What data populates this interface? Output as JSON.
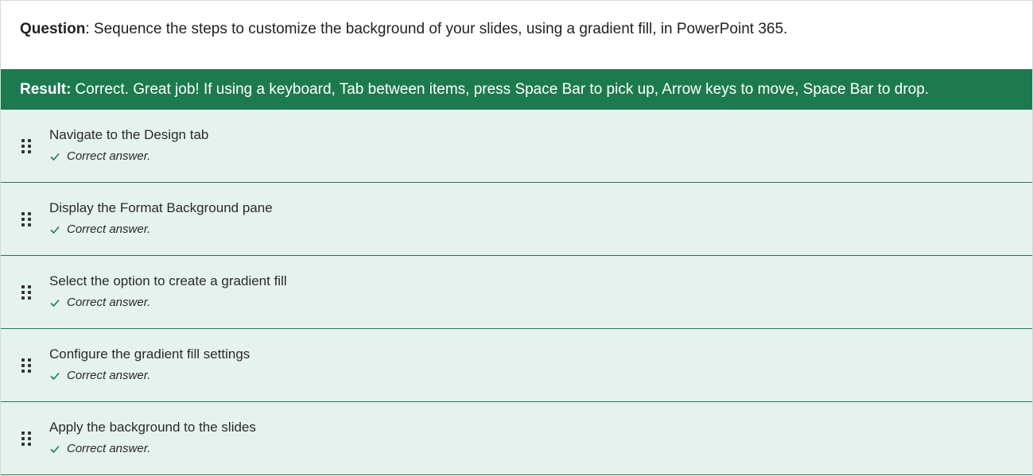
{
  "question": {
    "label": "Question",
    "separator": ":",
    "text": " Sequence the steps to customize the background of your slides, using a gradient fill, in PowerPoint 365."
  },
  "result": {
    "label": "Result:",
    "text": "Correct. Great job! If using a keyboard, Tab between items, press Space Bar to pick up, Arrow keys to move, Space Bar to drop."
  },
  "colors": {
    "result_bg": "#1d7a4f",
    "item_bg": "#e6f2ee",
    "check": "#1d7a4f"
  },
  "items": [
    {
      "label": "Navigate to the Design tab",
      "feedback": "Correct answer.",
      "drag_icon": "drag-handle-icon",
      "status_icon": "checkmark-icon"
    },
    {
      "label": "Display the Format Background pane",
      "feedback": "Correct answer.",
      "drag_icon": "drag-handle-icon",
      "status_icon": "checkmark-icon"
    },
    {
      "label": "Select the option to create a gradient fill",
      "feedback": "Correct answer.",
      "drag_icon": "drag-handle-icon",
      "status_icon": "checkmark-icon"
    },
    {
      "label": "Configure the gradient fill settings",
      "feedback": "Correct answer.",
      "drag_icon": "drag-handle-icon",
      "status_icon": "checkmark-icon"
    },
    {
      "label": "Apply the background to the slides",
      "feedback": "Correct answer.",
      "drag_icon": "drag-handle-icon",
      "status_icon": "checkmark-icon"
    }
  ]
}
